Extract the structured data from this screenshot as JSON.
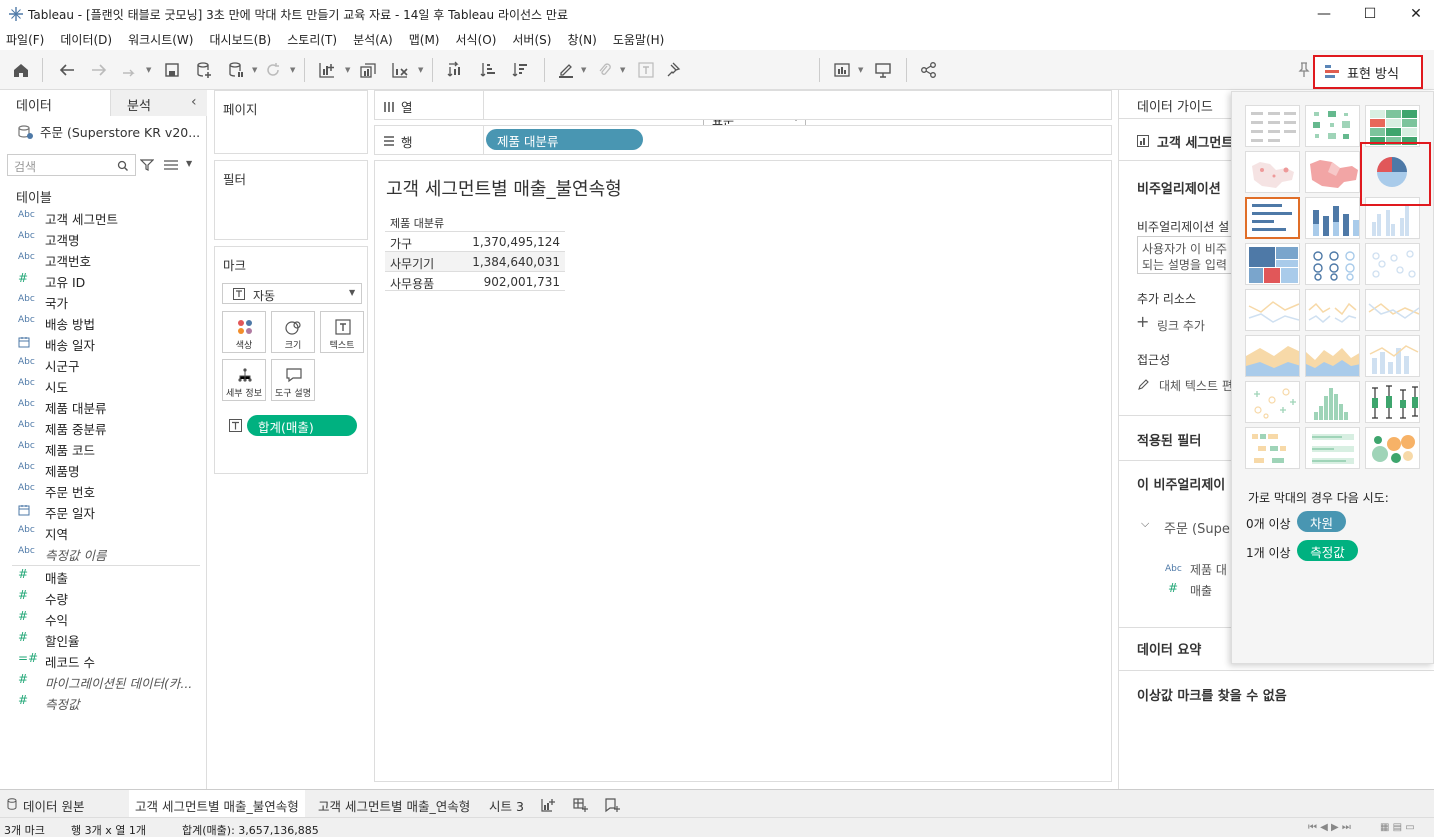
{
  "window": {
    "title": "Tableau - [플랜잇 태블로 굿모닝] 3초 만에 막대 차트 만들기 교육 자료 - 14일 후 Tableau 라이선스 만료",
    "minimize": "—",
    "maximize": "☐",
    "close": "✕"
  },
  "menu": [
    "파일(F)",
    "데이터(D)",
    "워크시트(W)",
    "대시보드(B)",
    "스토리(T)",
    "분석(A)",
    "맵(M)",
    "서식(O)",
    "서버(S)",
    "창(N)",
    "도움말(H)"
  ],
  "toolbar": {
    "fit_select": "표준",
    "show_me_label": "표현 방식"
  },
  "left_panel": {
    "tab_data": "데이터",
    "tab_analysis": "분석",
    "datasource": "주문 (Superstore KR v20...",
    "search_placeholder": "검색",
    "tables_header": "테이블",
    "dimensions": [
      {
        "type": "Abc",
        "name": "고객 세그먼트"
      },
      {
        "type": "Abc",
        "name": "고객명"
      },
      {
        "type": "Abc",
        "name": "고객번호"
      },
      {
        "type": "#",
        "name": "고유 ID"
      },
      {
        "type": "Abc",
        "name": "국가"
      },
      {
        "type": "Abc",
        "name": "배송 방법"
      },
      {
        "type": "cal",
        "name": "배송 일자"
      },
      {
        "type": "Abc",
        "name": "시군구"
      },
      {
        "type": "Abc",
        "name": "시도"
      },
      {
        "type": "Abc",
        "name": "제품 대분류"
      },
      {
        "type": "Abc",
        "name": "제품 중분류"
      },
      {
        "type": "Abc",
        "name": "제품 코드"
      },
      {
        "type": "Abc",
        "name": "제품명"
      },
      {
        "type": "Abc",
        "name": "주문 번호"
      },
      {
        "type": "cal",
        "name": "주문 일자"
      },
      {
        "type": "Abc",
        "name": "지역"
      },
      {
        "type": "Abc",
        "name": "측정값 이름"
      }
    ],
    "measures": [
      {
        "type": "#",
        "name": "매출"
      },
      {
        "type": "#",
        "name": "수량"
      },
      {
        "type": "#",
        "name": "수익"
      },
      {
        "type": "#",
        "name": "할인율"
      },
      {
        "type": "=#",
        "name": "레코드 수"
      },
      {
        "type": "#",
        "name": "마이그레이션된 데이터(카..."
      },
      {
        "type": "#",
        "name": "측정값"
      }
    ]
  },
  "shelves": {
    "pages": "페이지",
    "filters": "필터",
    "marks": "마크",
    "mark_type": "자동",
    "mark_buttons": [
      "색상",
      "크기",
      "텍스트",
      "세부 정보",
      "도구 설명"
    ],
    "mark_pill": "합계(매출)",
    "columns_label": "열",
    "rows_label": "행",
    "rows_pill": "제품 대분류"
  },
  "view": {
    "title": "고객 세그먼트별 매출_불연속형",
    "header": "제품 대분류",
    "rows": [
      {
        "label": "가구",
        "value": "1,370,495,124"
      },
      {
        "label": "사무기기",
        "value": "1,384,640,031"
      },
      {
        "label": "사무용품",
        "value": "902,001,731"
      }
    ]
  },
  "guide": {
    "header": "데이터 가이드",
    "sheet": "고객 세그먼트",
    "viz_desc_header": "비주얼리제이션",
    "viz_desc_label": "비주얼리제이션 설",
    "viz_desc_text1": "사용자가 이 비주",
    "viz_desc_text2": "되는 설명을 입력",
    "resources": "추가 리소스",
    "add_link": "링크 추가",
    "accessibility": "접근성",
    "alt_text": "대체 텍스트 편",
    "applied_filters": "적용된 필터",
    "this_viz": "이 비주얼리제이",
    "source": "주문 (Supe",
    "field1": "제품 대",
    "field2": "매출",
    "data_summary": "데이터 요약",
    "outliers": "이상값 마크를 찾을 수 없음"
  },
  "show_me": {
    "hint": "가로 막대의 경우 다음 시도:",
    "req1_prefix": "0개 이상",
    "req1_pill": "차원",
    "req2_prefix": "1개 이상",
    "req2_pill": "측정값"
  },
  "sheet_tabs": {
    "data_source": "데이터 원본",
    "tabs": [
      "고객 세그먼트별 매출_불연속형",
      "고객 세그먼트별 매출_연속형",
      "시트 3"
    ]
  },
  "status": {
    "marks": "3개 마크",
    "dims": "행 3개  x  열 1개",
    "sum": "합계(매출): 3,657,136,885"
  }
}
